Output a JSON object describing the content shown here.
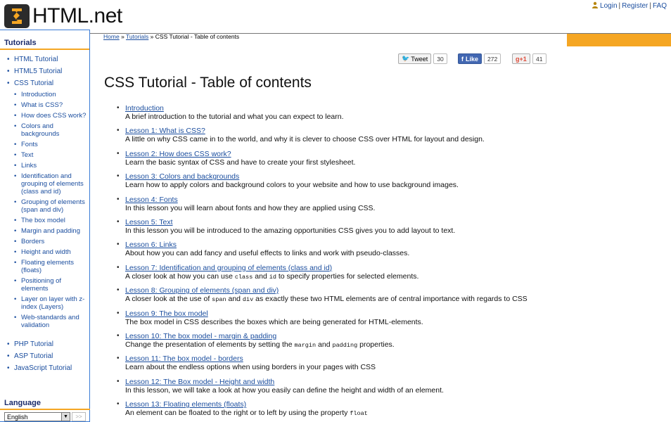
{
  "site": {
    "logo_text": "HTML",
    "logo_suffix": ".net"
  },
  "header": {
    "login": "Login",
    "register": "Register",
    "faq": "FAQ",
    "sep": "|"
  },
  "sidebar": {
    "heading": "Tutorials",
    "items": [
      {
        "label": "HTML Tutorial"
      },
      {
        "label": "HTML5 Tutorial"
      },
      {
        "label": "CSS Tutorial"
      }
    ],
    "css_sub": [
      "Introduction",
      "What is CSS?",
      "How does CSS work?",
      "Colors and backgrounds",
      "Fonts",
      "Text",
      "Links",
      "Identification and grouping of elements (class and id)",
      "Grouping of elements (span and div)",
      "The box model",
      "Margin and padding",
      "Borders",
      "Height and width",
      "Floating elements (floats)",
      "Positioning of elements",
      "Layer on layer with z-index (Layers)",
      "Web-standards and validation"
    ],
    "more_items": [
      "PHP Tutorial",
      "ASP Tutorial",
      "JavaScript Tutorial"
    ],
    "language_heading": "Language",
    "language_value": "English",
    "language_go": ">>"
  },
  "breadcrumb": {
    "home": "Home",
    "sep": "»",
    "tutorials": "Tutorials",
    "current": "CSS Tutorial - Table of contents"
  },
  "social": {
    "tweet_label": "Tweet",
    "tweet_count": "30",
    "like_label": "Like",
    "like_count": "272",
    "gplus_label": "+1",
    "gplus_count": "41"
  },
  "page": {
    "title": "CSS Tutorial - Table of contents"
  },
  "toc": [
    {
      "link": "Introduction",
      "desc": "A brief introduction to the tutorial and what you can expect to learn."
    },
    {
      "link": "Lesson 1: What is CSS?",
      "desc": "A little on why CSS came in to the world, and why it is clever to choose CSS over HTML for layout and design."
    },
    {
      "link": "Lesson 2: How does CSS work?",
      "desc": "Learn the basic syntax of CSS and have to create your first stylesheet."
    },
    {
      "link": "Lesson 3: Colors and backgrounds",
      "desc": "Learn how to apply colors and background colors to your website and how to use background images."
    },
    {
      "link": "Lesson 4: Fonts",
      "desc": "In this lesson you will learn about fonts and how they are applied using CSS."
    },
    {
      "link": "Lesson 5: Text",
      "desc": "In this lesson you will be introduced to the amazing opportunities CSS gives you to add layout to text."
    },
    {
      "link": "Lesson 6: Links",
      "desc": "About how you can add fancy and useful effects to links and work with pseudo-classes."
    },
    {
      "link": "Lesson 7: Identification and grouping of elements (class and id)",
      "desc_parts": [
        "A closer look at how you can use ",
        "class",
        " and ",
        "id",
        " to specify properties for selected elements."
      ]
    },
    {
      "link": "Lesson 8: Grouping of elements (span and div)",
      "desc_parts": [
        "A closer look at the use of ",
        "span",
        " and ",
        "div",
        " as exactly these two HTML elements are of central importance with regards to CSS"
      ]
    },
    {
      "link": "Lesson 9: The box model",
      "desc": "The box model in CSS describes the boxes which are being generated for HTML-elements."
    },
    {
      "link": "Lesson 10: The box model - margin & padding",
      "desc_parts": [
        "Change the presentation of elements by setting the ",
        "margin",
        " and ",
        "padding",
        " properties."
      ]
    },
    {
      "link": "Lesson 11: The box model - borders",
      "desc": "Learn about the endless options when using borders in your pages with CSS"
    },
    {
      "link": "Lesson 12: The Box model - Height and width",
      "desc": "In this lesson, we will take a look at how you easily can define the height and width of an element."
    },
    {
      "link": "Lesson 13: Floating elements (floats)",
      "desc_parts": [
        "An element can be floated to the right or to left by using the property ",
        "float",
        "",
        "",
        ""
      ]
    }
  ]
}
